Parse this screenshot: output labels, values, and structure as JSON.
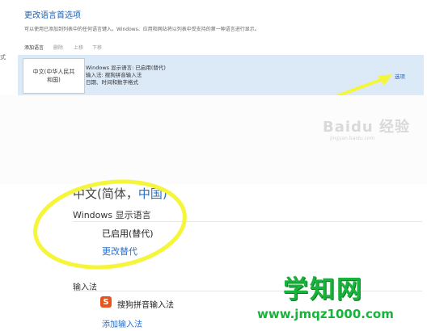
{
  "top": {
    "title": "更改语言首选项",
    "description": "可以使用已添加到列表中的任何语言键入。Windows、应用和网站将以列表中受支持的第一种语言进行显示。",
    "left_mark": "式",
    "toolbar": {
      "add_label": "添加语言",
      "delete_label": "删除",
      "up_label": "上移",
      "down_label": "下移"
    },
    "language_row": {
      "tile_line1": "中文(中华人民共",
      "tile_line2": "和国)",
      "info_line1": "Windows 显示语言: 已启用(替代)",
      "info_line2": "输入法: 搜狗拼音输入法",
      "info_line3": "日期、时间和数字格式",
      "options_label": "选项"
    },
    "watermark_text": "Baidu 经验",
    "watermark_url": "jingyan.baidu.com"
  },
  "detail": {
    "heading_prefix": "中文(简体，",
    "heading_blue": "中国)",
    "display_language_label": "Windows 显示语言",
    "enabled_status": "已启用(替代)",
    "change_override_link": "更改替代",
    "input_method_heading": "输入法",
    "ime_icon_glyph": "S",
    "ime_name": "搜狗拼音输入法",
    "add_ime_link": "添加输入法"
  },
  "watermark": {
    "big_text": "学知网",
    "url_text": "www.jmqz1000.com"
  },
  "colors": {
    "accent_blue": "#2a6fc9",
    "row_highlight": "#dceaf8",
    "annotation_yellow": "#f5f53a",
    "watermark_green": "#18b33a",
    "ime_orange": "#e8541c"
  }
}
